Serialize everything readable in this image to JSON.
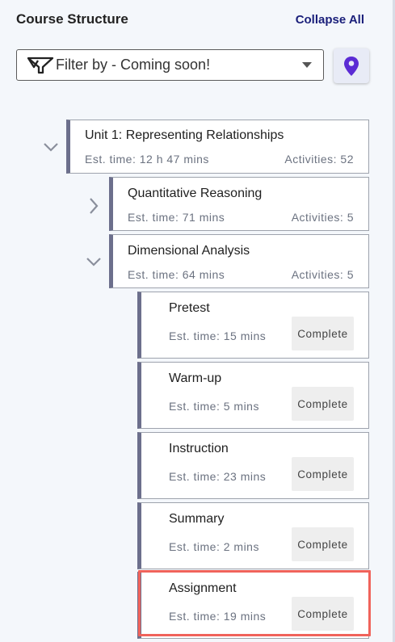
{
  "header": {
    "title": "Course Structure",
    "collapse_label": "Collapse All"
  },
  "filter": {
    "label": "Filter by - Coming soon!",
    "icon": "wyzant-filter-icon"
  },
  "pin_button": {
    "icon": "location-pin-icon",
    "color": "#5b2bd4"
  },
  "unit": {
    "name": "Unit 1: Representing Relationships",
    "est": "Est. time: 12 h 47 mins",
    "activities": "Activities: 52",
    "expanded": true
  },
  "lessons": [
    {
      "name": "Quantitative Reasoning",
      "est": "Est. time: 71 mins",
      "activities": "Activities: 5",
      "expanded": false
    },
    {
      "name": "Dimensional Analysis",
      "est": "Est. time: 64 mins",
      "activities": "Activities: 5",
      "expanded": true
    }
  ],
  "activities": [
    {
      "name": "Pretest",
      "est": "Est. time: 15 mins",
      "status": "Complete"
    },
    {
      "name": "Warm-up",
      "est": "Est. time: 5 mins",
      "status": "Complete"
    },
    {
      "name": "Instruction",
      "est": "Est. time: 23 mins",
      "status": "Complete"
    },
    {
      "name": "Summary",
      "est": "Est. time: 2 mins",
      "status": "Complete"
    },
    {
      "name": "Assignment",
      "est": "Est. time: 19 mins",
      "status": "Complete",
      "highlighted": true
    }
  ],
  "colors": {
    "accent_border": "#6c6f8c",
    "highlight": "#f0635b",
    "link": "#1a1f7a"
  }
}
